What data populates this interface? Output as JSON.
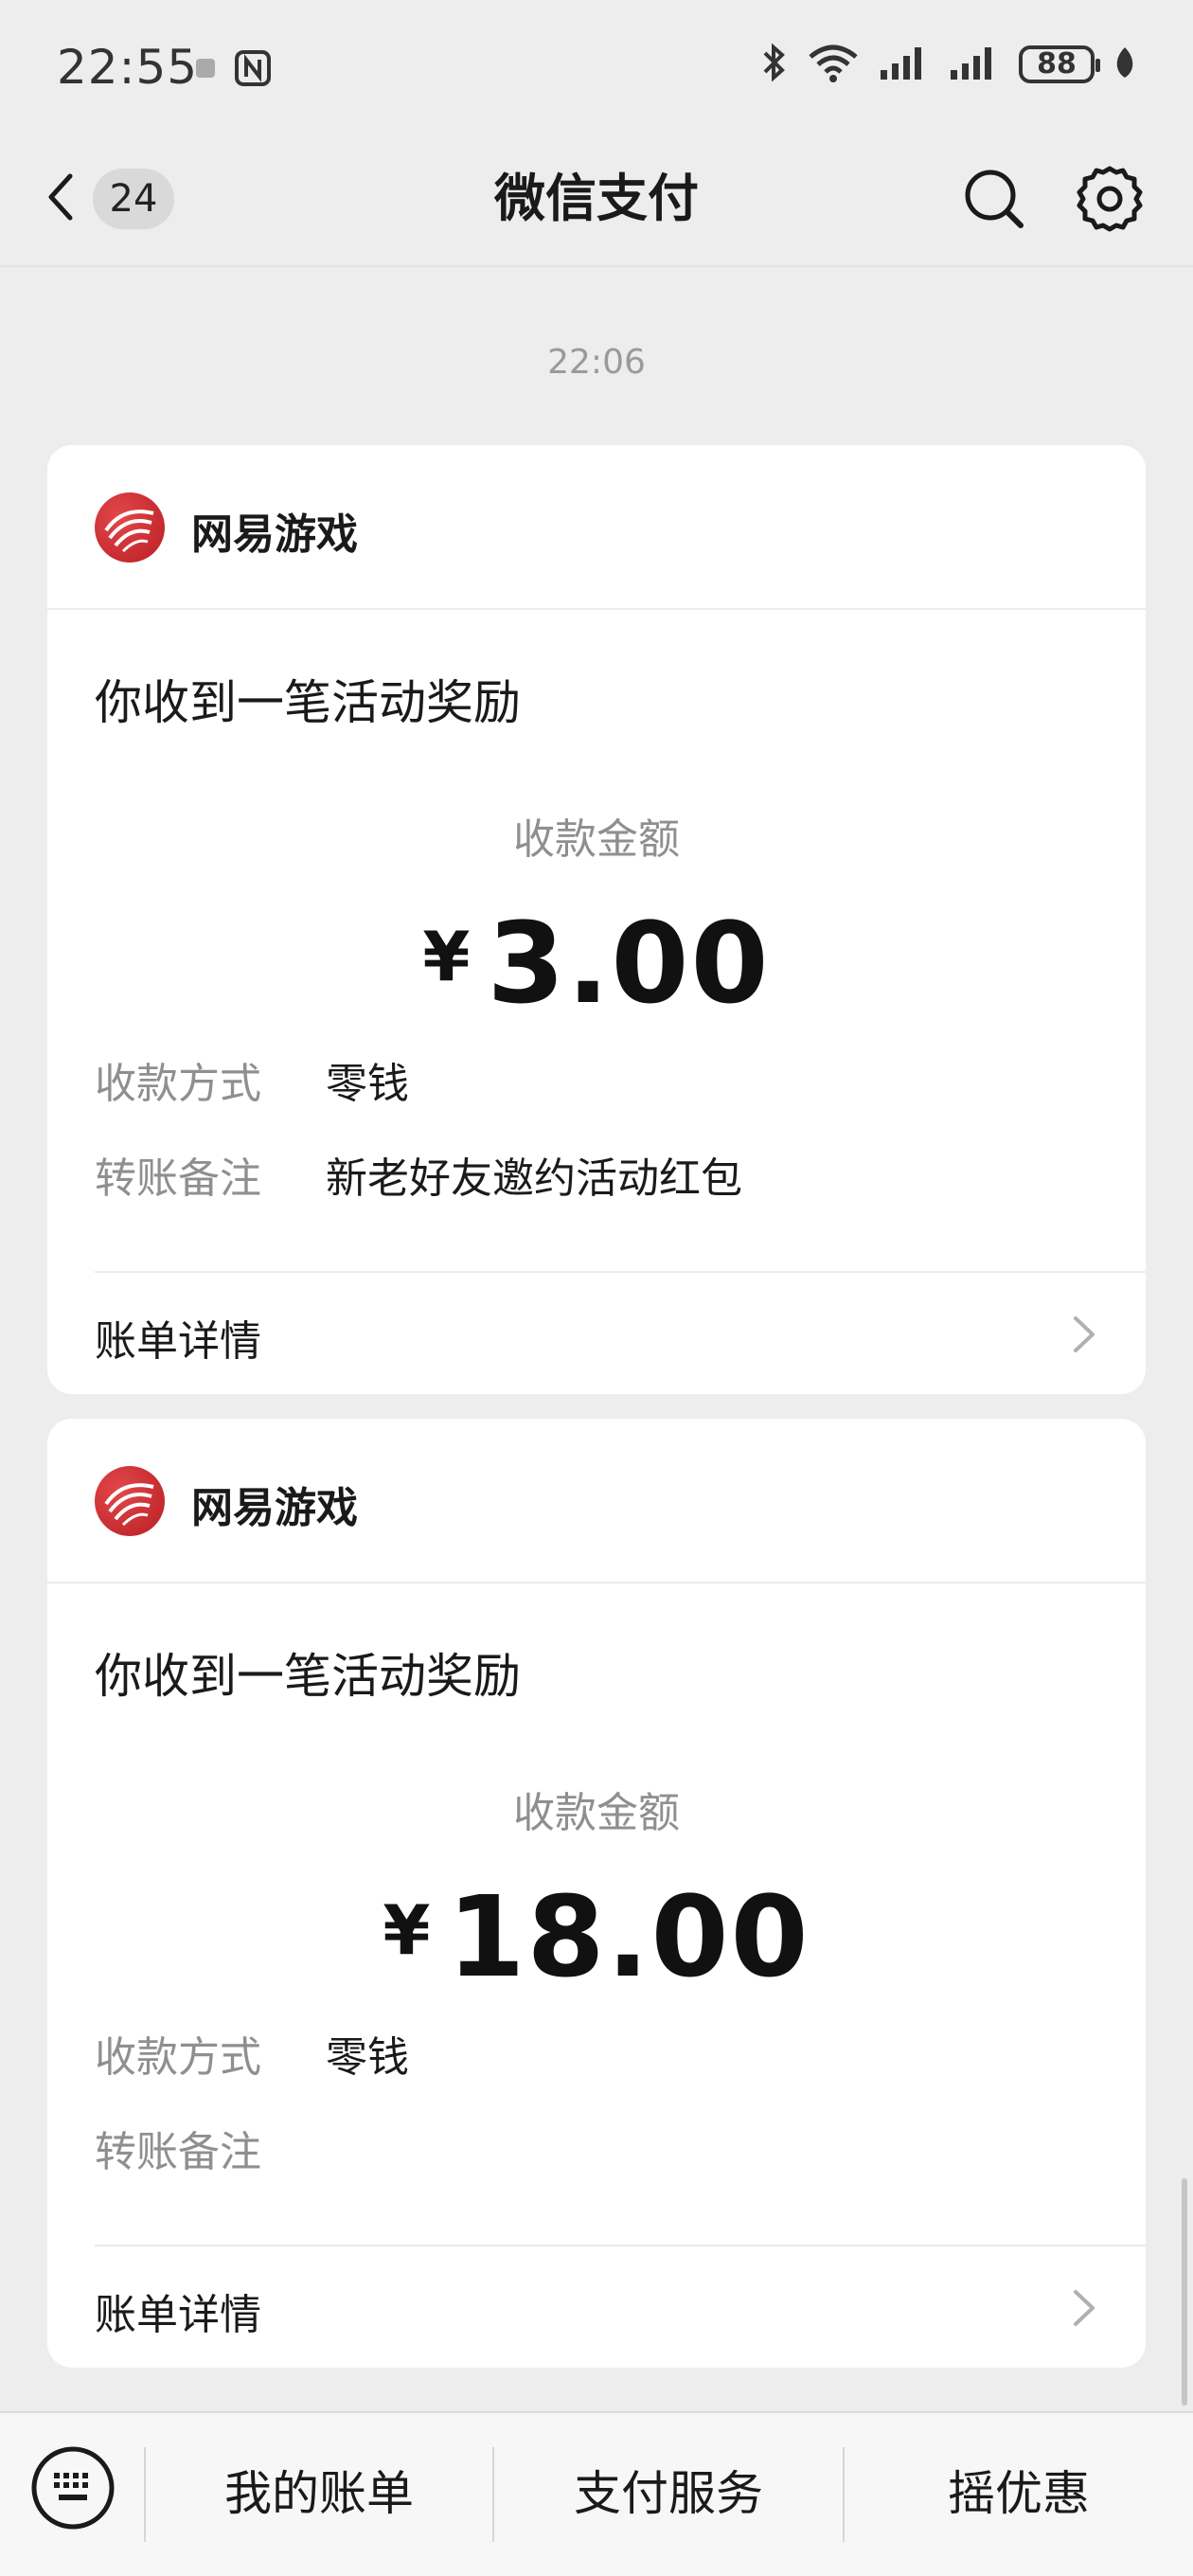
{
  "status_bar": {
    "time": "22:55",
    "battery": "88"
  },
  "nav": {
    "back_count": "24",
    "title": "微信支付"
  },
  "timestamp": "22:06",
  "messages": [
    {
      "merchant": "网易游戏",
      "title": "你收到一笔活动奖励",
      "amount_label": "收款金额",
      "currency": "¥",
      "amount": "3.00",
      "fields": [
        {
          "label": "收款方式",
          "value": "零钱"
        },
        {
          "label": "转账备注",
          "value": "新老好友邀约活动红包"
        }
      ],
      "detail_label": "账单详情"
    },
    {
      "merchant": "网易游戏",
      "title": "你收到一笔活动奖励",
      "amount_label": "收款金额",
      "currency": "¥",
      "amount": "18.00",
      "fields": [
        {
          "label": "收款方式",
          "value": "零钱"
        },
        {
          "label": "转账备注",
          "value": ""
        }
      ],
      "detail_label": "账单详情"
    }
  ],
  "bottom_bar": {
    "items": [
      "我的账单",
      "支付服务",
      "摇优惠"
    ]
  }
}
